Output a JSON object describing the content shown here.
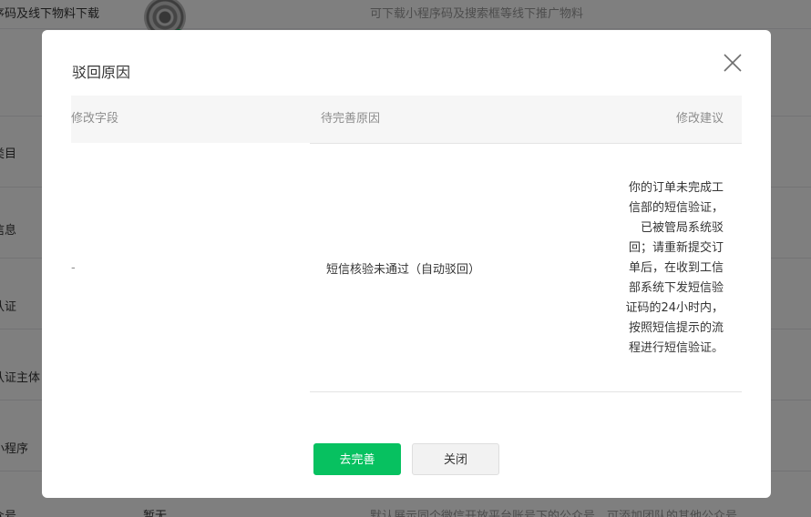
{
  "background": {
    "rows": [
      {
        "label": "序码及线下物料下载",
        "value": "",
        "desc": "可下载小程序码及搜索框等线下推广物料"
      },
      {
        "label": "",
        "value": "",
        "desc": ""
      },
      {
        "label": "类目",
        "value": "",
        "desc": ""
      },
      {
        "label": "信息",
        "value": "",
        "desc": ""
      },
      {
        "label": "认证",
        "value": "",
        "desc": ""
      },
      {
        "label": "认证主体",
        "value": "",
        "desc": ""
      },
      {
        "label": "小程序",
        "value": "",
        "desc": ""
      },
      {
        "label": "众号",
        "value": "暂无",
        "desc": "默认展示同个微信开放平台账号下的公众号，可添加团队的其他公众号"
      }
    ]
  },
  "dialog": {
    "title": "驳回原因",
    "close_icon": "close-icon",
    "table": {
      "headers": {
        "field": "修改字段",
        "reason": "待完善原因",
        "suggestion": "修改建议"
      },
      "rows": [
        {
          "field": "-",
          "reason": "短信核验未通过（自动驳回）",
          "suggestion_lines": [
            "你的订单未完成工",
            "信部的短信验证，",
            "已被管局系统驳",
            "回；请重新提交订",
            "单后，在收到工信",
            "部系统下发短信验",
            "证码的24小时内，",
            "按照短信提示的流",
            "程进行短信验证。"
          ]
        }
      ]
    },
    "buttons": {
      "primary": "去完善",
      "close": "关闭"
    }
  },
  "colors": {
    "primary": "#07c160",
    "mask": "rgba(0,0,0,0.5)"
  }
}
